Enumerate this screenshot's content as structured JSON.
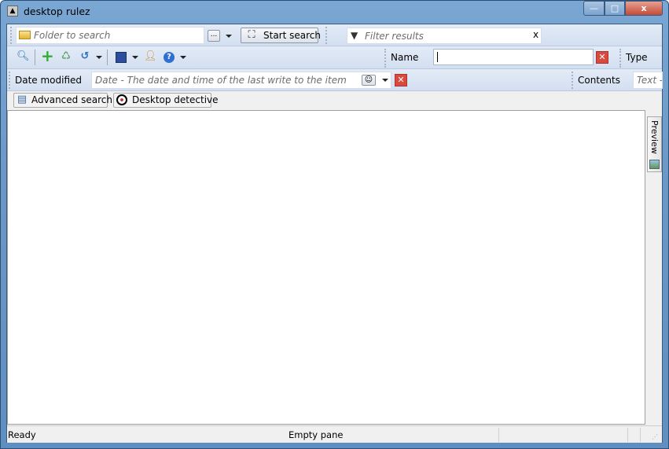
{
  "window": {
    "title": "desktop rulez",
    "minimize": "—",
    "maximize": "□",
    "close": "x"
  },
  "toolbar1": {
    "folder_placeholder": "Folder to search",
    "browse_label": "...",
    "start_search": "Start search",
    "filter_placeholder": "Filter results",
    "filter_clear": "x"
  },
  "toolbar2": {
    "name_label": "Name",
    "name_value": "",
    "type_label": "Type"
  },
  "toolbar3": {
    "date_label": "Date modified",
    "date_placeholder": "Date - The date and time of the last write to the item",
    "contents_label": "Contents",
    "contents_placeholder": "Text - "
  },
  "toolbar4": {
    "advanced_search": "Advanced search",
    "desktop_detective": "Desktop detective"
  },
  "side": {
    "preview": "Preview"
  },
  "status": {
    "left": "Ready",
    "center": "Empty pane"
  }
}
